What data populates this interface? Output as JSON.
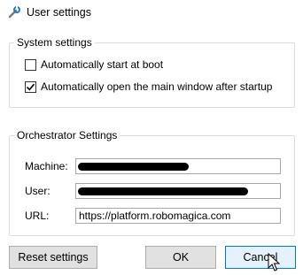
{
  "window": {
    "title": "User settings",
    "icon": "gear-icon"
  },
  "system_settings": {
    "legend": "System settings",
    "options": [
      {
        "label": "Automatically start at boot",
        "checked": false
      },
      {
        "label": "Automatically open the main window after startup",
        "checked": true
      }
    ]
  },
  "orchestrator_settings": {
    "legend": "Orchestrator Settings",
    "fields": [
      {
        "label": "Machine:",
        "value": "",
        "masked": true
      },
      {
        "label": "User:",
        "value": "",
        "masked": true
      },
      {
        "label": "URL:",
        "value": "https://platform.robomagica.com",
        "masked": false
      }
    ]
  },
  "buttons": {
    "reset": "Reset settings",
    "ok": "OK",
    "cancel": "Cancel"
  }
}
